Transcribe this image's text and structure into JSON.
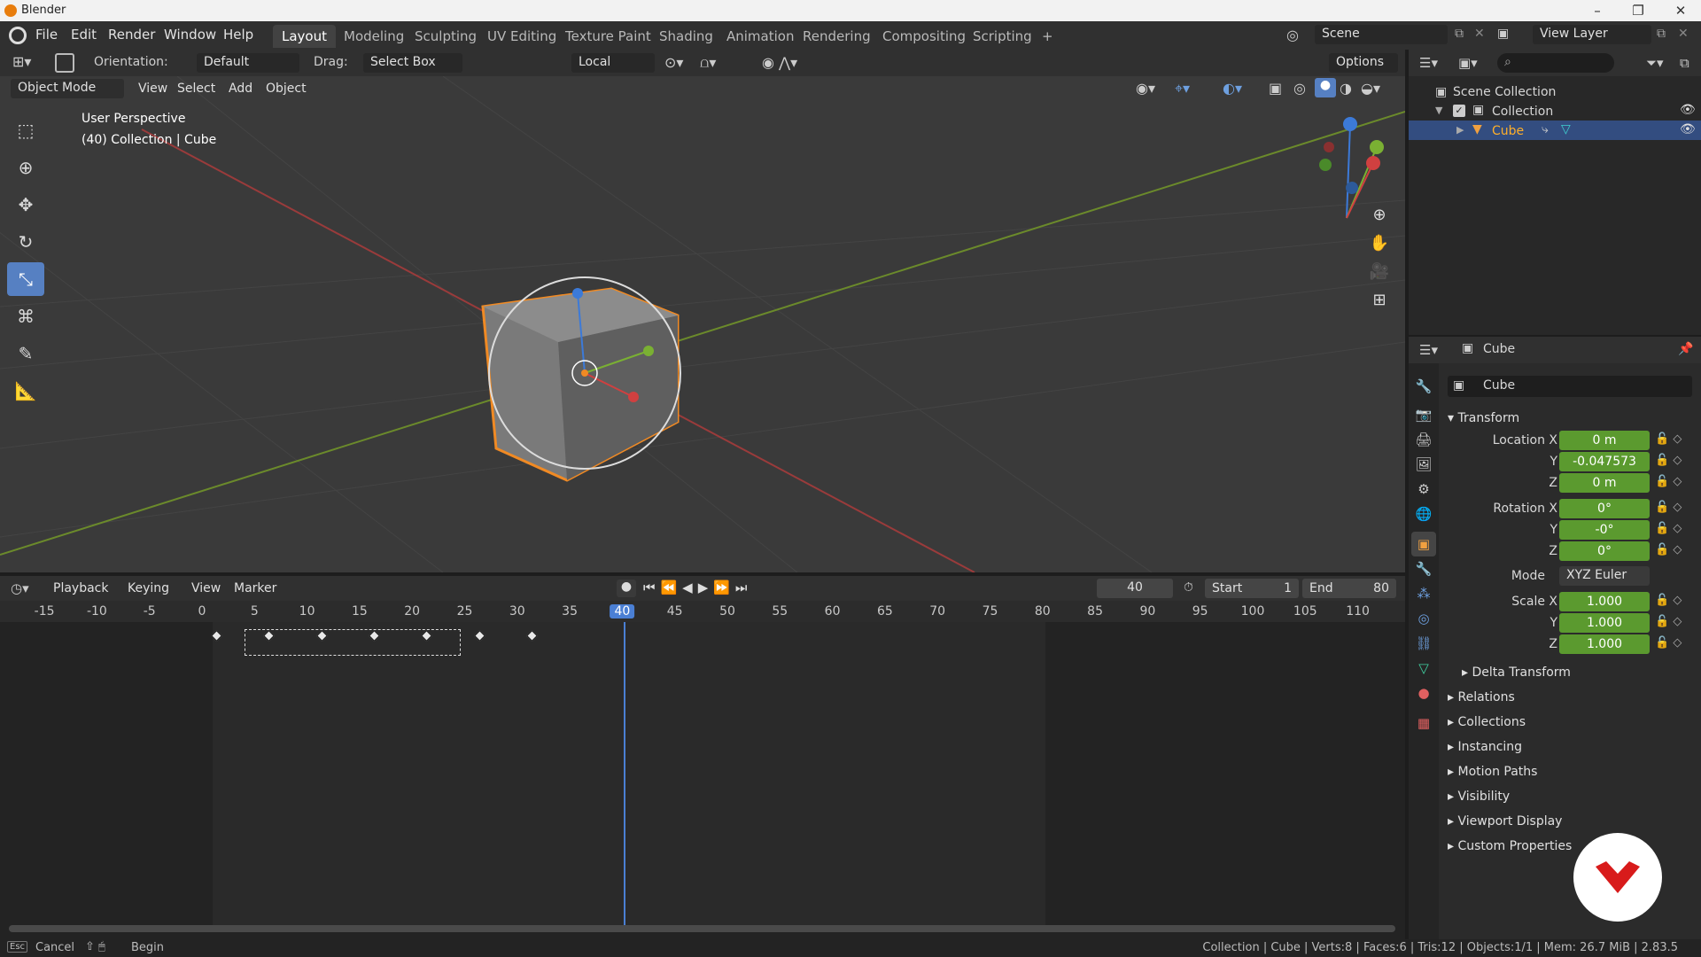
{
  "os": {
    "title": "Blender",
    "minimize": "–",
    "maximize": "❐",
    "close": "✕"
  },
  "menus": [
    "File",
    "Edit",
    "Render",
    "Window",
    "Help"
  ],
  "workspaces": [
    "Layout",
    "Modeling",
    "Sculpting",
    "UV Editing",
    "Texture Paint",
    "Shading",
    "Animation",
    "Rendering",
    "Compositing",
    "Scripting"
  ],
  "add_tab": "+",
  "scene": {
    "label": "Scene",
    "view_layer": "View Layer"
  },
  "toolbar": {
    "orientation_label": "Orientation:",
    "orientation_value": "Default",
    "drag_label": "Drag:",
    "drag_value": "Select Box",
    "pivot_value": "Local",
    "options": "Options"
  },
  "viewport": {
    "mode": "Object Mode",
    "menus": [
      "View",
      "Select",
      "Add",
      "Object"
    ],
    "perspective": "User Perspective",
    "collection_info": "(40) Collection | Cube"
  },
  "timeline": {
    "menus": [
      "Playback",
      "Keying",
      "View",
      "Marker"
    ],
    "current_frame": "40",
    "start_label": "Start",
    "start_value": "1",
    "end_label": "End",
    "end_value": "80",
    "ruler": [
      "-15",
      "-10",
      "-5",
      "0",
      "5",
      "10",
      "15",
      "20",
      "25",
      "30",
      "35",
      "40",
      "45",
      "50",
      "55",
      "60",
      "65",
      "70",
      "75",
      "80",
      "85",
      "90",
      "95",
      "100",
      "105",
      "110"
    ],
    "keyframes": [
      0,
      5,
      10,
      15,
      20,
      25,
      30
    ]
  },
  "outliner": {
    "scene_collection": "Scene Collection",
    "collection": "Collection",
    "object": "Cube"
  },
  "properties": {
    "header": "Cube",
    "object_name": "Cube",
    "transform_label": "Transform",
    "location": {
      "label": "Location X",
      "x": "0 m",
      "y": "-0.047573",
      "z": "0 m"
    },
    "rotation": {
      "label": "Rotation X",
      "x": "0°",
      "y": "-0°",
      "z": "0°"
    },
    "mode_label": "Mode",
    "mode_value": "XYZ Euler",
    "scale": {
      "label": "Scale X",
      "x": "1.000",
      "y": "1.000",
      "z": "1.000"
    },
    "axis_y": "Y",
    "axis_z": "Z",
    "panels": [
      "Delta Transform",
      "Relations",
      "Collections",
      "Instancing",
      "Motion Paths",
      "Visibility",
      "Viewport Display",
      "Custom Properties"
    ]
  },
  "status": {
    "cancel": "Cancel",
    "begin": "Begin",
    "info": "Collection | Cube | Verts:8 | Faces:6 | Tris:12 | Objects:1/1 | Mem: 26.7 MiB | 2.83.5"
  },
  "colors": {
    "accent": "#5680c2",
    "field": "#5b9a2f",
    "select": "#e87d0d"
  }
}
